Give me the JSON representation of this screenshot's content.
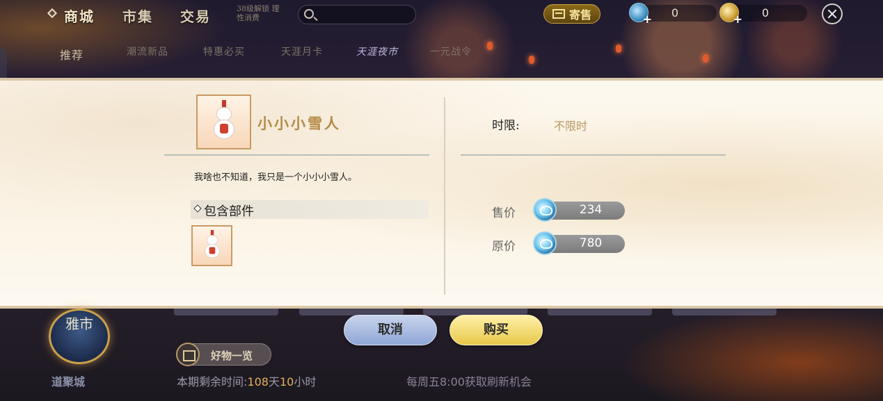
{
  "topbar": {
    "nav": [
      "商城",
      "市集",
      "交易"
    ],
    "note": "38级解锁 理性消费",
    "search_placeholder": "",
    "consign_label": "寄售",
    "currency_blue": "0",
    "currency_gold": "0"
  },
  "subtabs": {
    "recommend": "推荐",
    "items": [
      "潮流新品",
      "特惠必买",
      "天涯月卡",
      "天涯夜市",
      "一元战令"
    ]
  },
  "item": {
    "name": "小小小雪人",
    "description": "我啥也不知道，我只是一个小小小雪人。",
    "parts_title": "包含部件",
    "time_label": "时限:",
    "time_value": "不限时",
    "sale_price_label": "售价",
    "sale_price": "234",
    "original_price_label": "原价",
    "original_price": "780"
  },
  "actions": {
    "cancel": "取消",
    "buy": "购买"
  },
  "bottom": {
    "emblem": "雅市",
    "logo": "道聚城",
    "goods_label": "好物一览",
    "remaining_prefix": "本期剩余时间:",
    "remaining_days": "108",
    "remaining_day_unit": "天",
    "remaining_hours": "10",
    "remaining_hour_unit": "小时",
    "refresh_note": "每周五8:00获取刷新机会"
  }
}
